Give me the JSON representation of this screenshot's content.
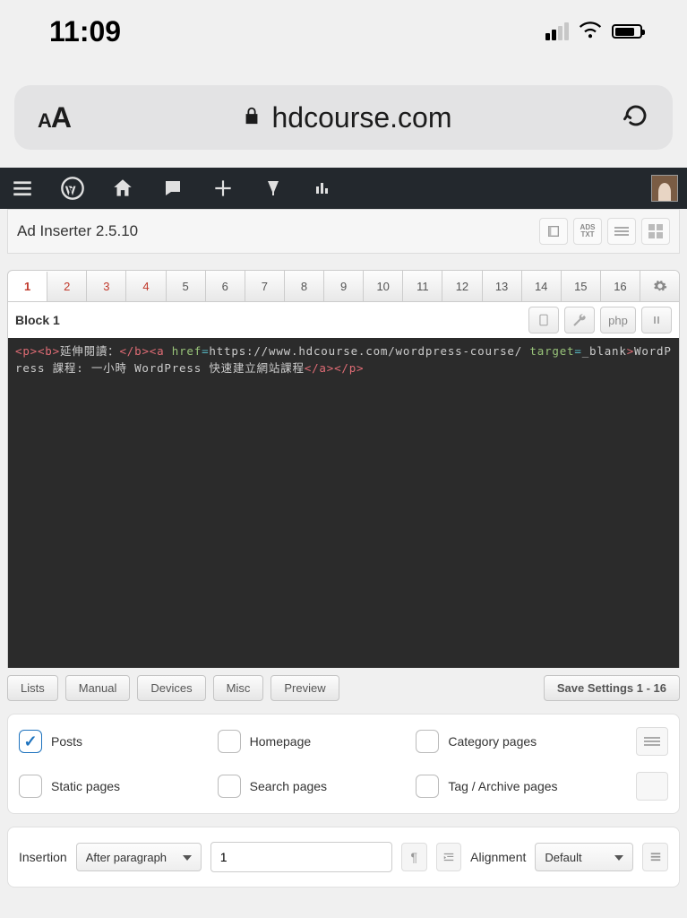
{
  "status": {
    "time": "11:09"
  },
  "browser": {
    "domain": "hdcourse.com"
  },
  "plugin": {
    "title": "Ad Inserter 2.5.10",
    "ads_txt": "ADS\nTXT"
  },
  "tabs": [
    "1",
    "2",
    "3",
    "4",
    "5",
    "6",
    "7",
    "8",
    "9",
    "10",
    "11",
    "12",
    "13",
    "14",
    "15",
    "16"
  ],
  "active_tab": 0,
  "block": {
    "title": "Block 1",
    "php_label": "php"
  },
  "editor": {
    "tokens": [
      {
        "t": "tag",
        "v": "<p><b>"
      },
      {
        "t": "text",
        "v": "延伸閱讀："
      },
      {
        "t": "tag",
        "v": "</b><a "
      },
      {
        "t": "attr",
        "v": "href"
      },
      {
        "t": "eq",
        "v": "="
      },
      {
        "t": "val",
        "v": "https://www.hdcourse.com/wordpress-course/ "
      },
      {
        "t": "attr",
        "v": "target"
      },
      {
        "t": "eq",
        "v": "="
      },
      {
        "t": "val",
        "v": "_blank"
      },
      {
        "t": "tag",
        "v": ">"
      },
      {
        "t": "text",
        "v": "WordPress 課程: 一小時 WordPress 快速建立網站課程"
      },
      {
        "t": "tag",
        "v": "</a></p>"
      }
    ]
  },
  "option_buttons": {
    "lists": "Lists",
    "manual": "Manual",
    "devices": "Devices",
    "misc": "Misc",
    "preview": "Preview",
    "save": "Save Settings 1 - 16"
  },
  "checks": {
    "posts": "Posts",
    "homepage": "Homepage",
    "category": "Category pages",
    "static": "Static pages",
    "search": "Search pages",
    "tag": "Tag / Archive pages"
  },
  "insertion": {
    "label": "Insertion",
    "mode": "After paragraph",
    "value": "1",
    "alignment_label": "Alignment",
    "alignment_value": "Default"
  }
}
